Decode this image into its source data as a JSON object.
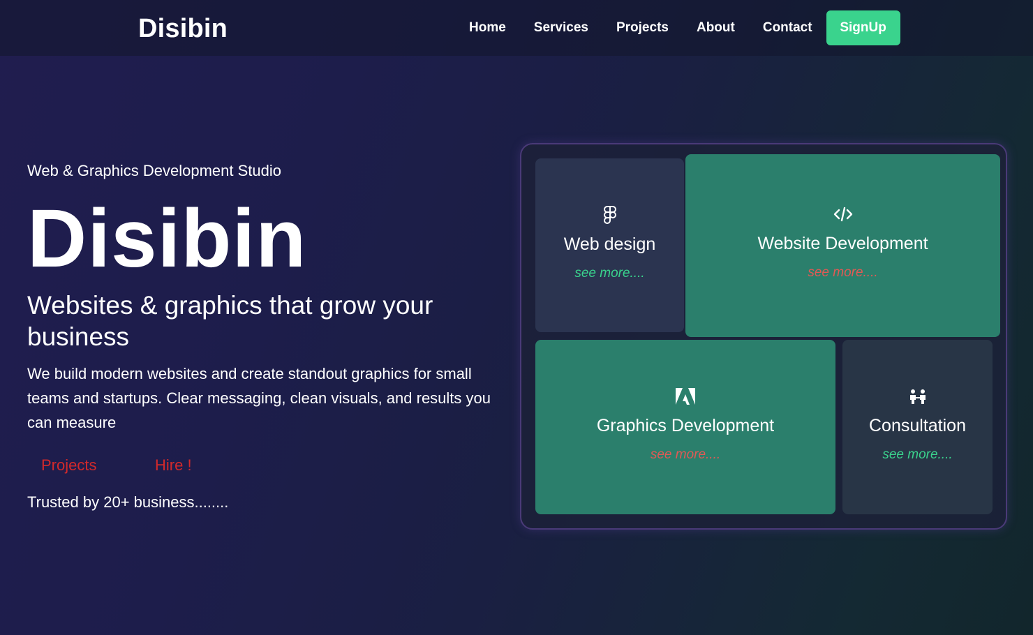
{
  "nav": {
    "brand": "Disibin",
    "links": [
      "Home",
      "Services",
      "Projects",
      "About",
      "Contact"
    ],
    "signup_label": "SignUp"
  },
  "hero": {
    "eyebrow": "Web & Graphics Development Studio",
    "title": "Disibin",
    "subtitle": "Websites & graphics that grow your business",
    "description": "We build modern websites and create standout graphics for small teams and startups. Clear messaging, clean visuals, and results you can measure",
    "buttons": {
      "projects": "Projects",
      "hire": "Hire !"
    },
    "trusted": "Trusted by 20+ business........"
  },
  "services": [
    {
      "title": "Web design",
      "more": "see more....",
      "icon": "figma-icon"
    },
    {
      "title": "Website Development",
      "more": "see more....",
      "icon": "code-icon"
    },
    {
      "title": "Graphics Development",
      "more": "see more....",
      "icon": "adobe-icon"
    },
    {
      "title": "Consultation",
      "more": "see more....",
      "icon": "people-icon"
    }
  ],
  "colors": {
    "accent": "#3ad38d",
    "card_green": "#2b7f6c",
    "hero_button_text": "#d2292b",
    "see_more_red": "#e05a55"
  }
}
